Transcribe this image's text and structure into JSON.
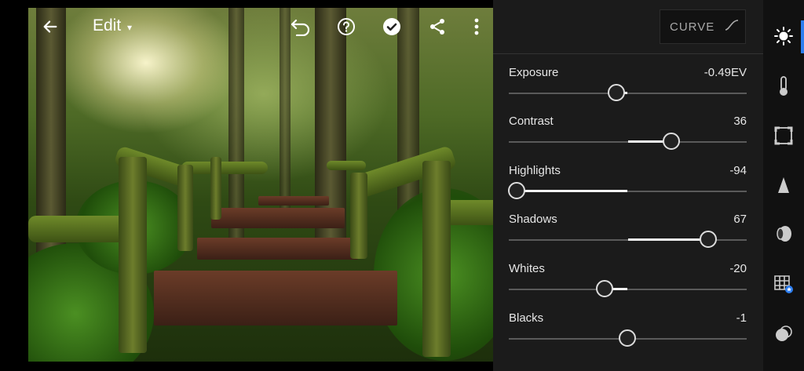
{
  "toolbar": {
    "edit_label": "Edit"
  },
  "curve": {
    "label": "CURVE"
  },
  "sliders": [
    {
      "name": "Exposure",
      "value": "-0.49EV",
      "position": 0.45,
      "fill_from": 0.5,
      "fill_to": 0.45
    },
    {
      "name": "Contrast",
      "value": "36",
      "position": 0.68,
      "fill_from": 0.5,
      "fill_to": 0.68
    },
    {
      "name": "Highlights",
      "value": "-94",
      "position": 0.03,
      "fill_from": 0.03,
      "fill_to": 0.5
    },
    {
      "name": "Shadows",
      "value": "67",
      "position": 0.835,
      "fill_from": 0.5,
      "fill_to": 0.835
    },
    {
      "name": "Whites",
      "value": "-20",
      "position": 0.4,
      "fill_from": 0.4,
      "fill_to": 0.5
    },
    {
      "name": "Blacks",
      "value": "-1",
      "position": 0.495,
      "fill_from": 0.495,
      "fill_to": 0.5
    }
  ],
  "tools": [
    {
      "icon": "light-icon"
    },
    {
      "icon": "color-icon"
    },
    {
      "icon": "crop-icon"
    },
    {
      "icon": "detail-icon"
    },
    {
      "icon": "optics-icon"
    },
    {
      "icon": "geometry-icon"
    },
    {
      "icon": "effects-icon"
    }
  ],
  "colors": {
    "panel_bg": "#1b1b1b",
    "accent": "#2d7ef0"
  }
}
